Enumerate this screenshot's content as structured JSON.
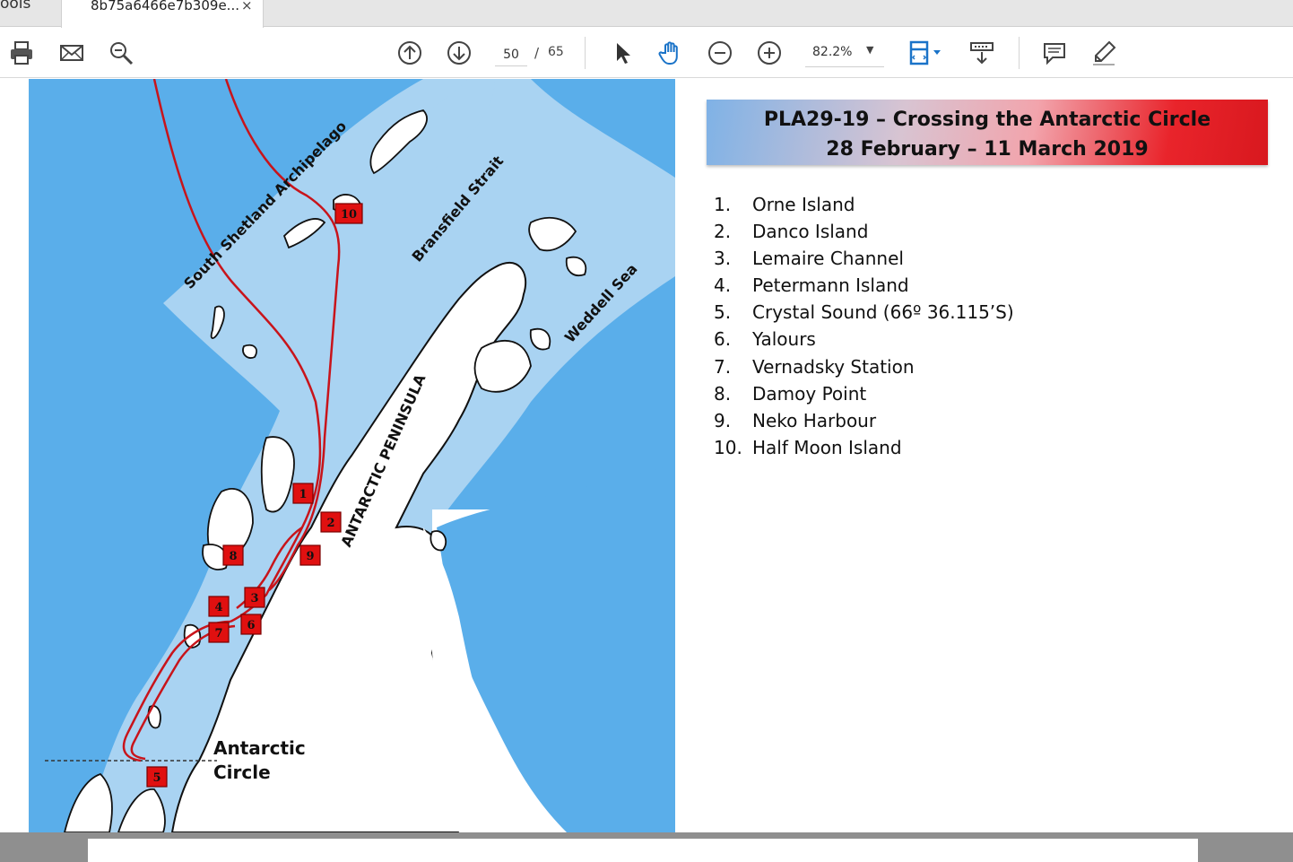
{
  "tabs": {
    "tools_label": "ools",
    "doc_label": "8b75a6466e7b309e...",
    "close_glyph": "×"
  },
  "toolbar": {
    "icons": [
      "print-icon",
      "email-icon",
      "zoom-search-icon",
      "page-up-icon",
      "page-down-icon",
      "select-cursor-icon",
      "hand-tool-icon",
      "zoom-out-icon",
      "zoom-in-icon",
      "fit-page-icon",
      "scroll-mode-icon",
      "comment-icon",
      "highlight-pen-icon"
    ],
    "current_page": "50",
    "page_separator": "/",
    "total_pages": "65",
    "zoom": "82.2%",
    "accent_color": "#1a73c8"
  },
  "document": {
    "title_line1": "PLA29-19 – Crossing the Antarctic Circle",
    "title_line2": "28 February – 11 March 2019",
    "stops": [
      {
        "num": "1.",
        "name": "Orne Island"
      },
      {
        "num": "2.",
        "name": "Danco Island"
      },
      {
        "num": "3.",
        "name": "Lemaire Channel"
      },
      {
        "num": "4.",
        "name": "Petermann Island"
      },
      {
        "num": "5.",
        "name": "Crystal Sound (66º 36.115’S)"
      },
      {
        "num": "6.",
        "name": "Yalours"
      },
      {
        "num": "7.",
        "name": "Vernadsky Station"
      },
      {
        "num": "8.",
        "name": "Damoy Point"
      },
      {
        "num": "9.",
        "name": "Neko Harbour"
      },
      {
        "num": "10.",
        "name": "Half Moon Island"
      }
    ],
    "map": {
      "labels": {
        "south_shetland": "South Shetland Archipelago",
        "bransfield": "Bransfield Strait",
        "weddell": "Weddell Sea",
        "peninsula": "ANTARCTIC PENINSULA",
        "circle_line1": "Antarctic",
        "circle_line2": "Circle"
      },
      "markers": [
        "1",
        "2",
        "3",
        "4",
        "5",
        "6",
        "7",
        "8",
        "9",
        "10"
      ],
      "colors": {
        "deep_water": "#5aaeea",
        "shallow_water": "#a9d3f2",
        "land": "#ffffff",
        "route": "#c8141b",
        "marker": "#e01010"
      }
    }
  }
}
